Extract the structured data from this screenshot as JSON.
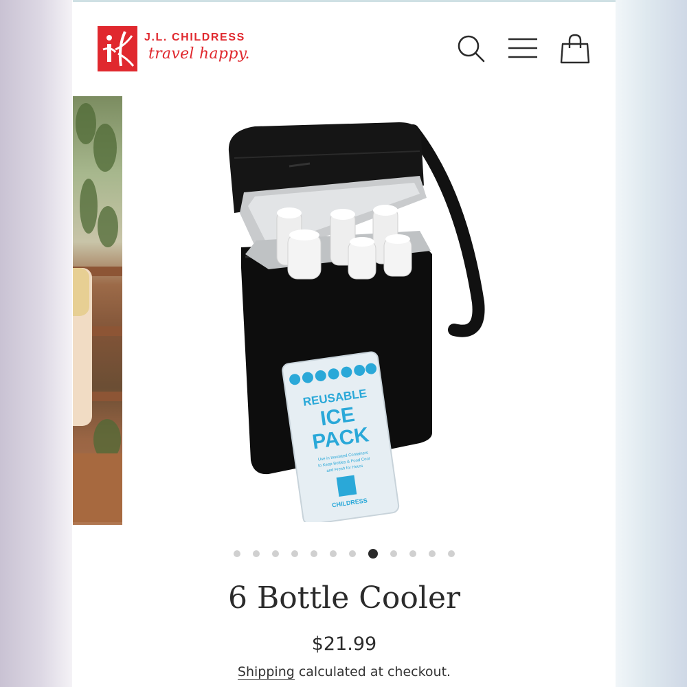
{
  "header": {
    "brand_name": "J.L. CHILDRESS",
    "brand_tagline": "travel happy.",
    "icons": [
      "search-icon",
      "hamburger-menu-icon",
      "shopping-bag-icon"
    ],
    "accent_color": "#e0282e"
  },
  "product_image": {
    "ice_pack": {
      "line1": "REUSABLE",
      "line2": "ICE",
      "line3": "PACK",
      "fine_print_1": "Use in Insulated Containers",
      "fine_print_2": "to Keep Bottles & Food Cool",
      "fine_print_3": "and Fresh for Hours",
      "brand": "CHILDRESS"
    }
  },
  "carousel": {
    "total_slides": 12,
    "active_index": 7
  },
  "product": {
    "title": "6 Bottle Cooler",
    "price": "$21.99",
    "shipping_link": "Shipping",
    "shipping_rest": " calculated at checkout."
  }
}
